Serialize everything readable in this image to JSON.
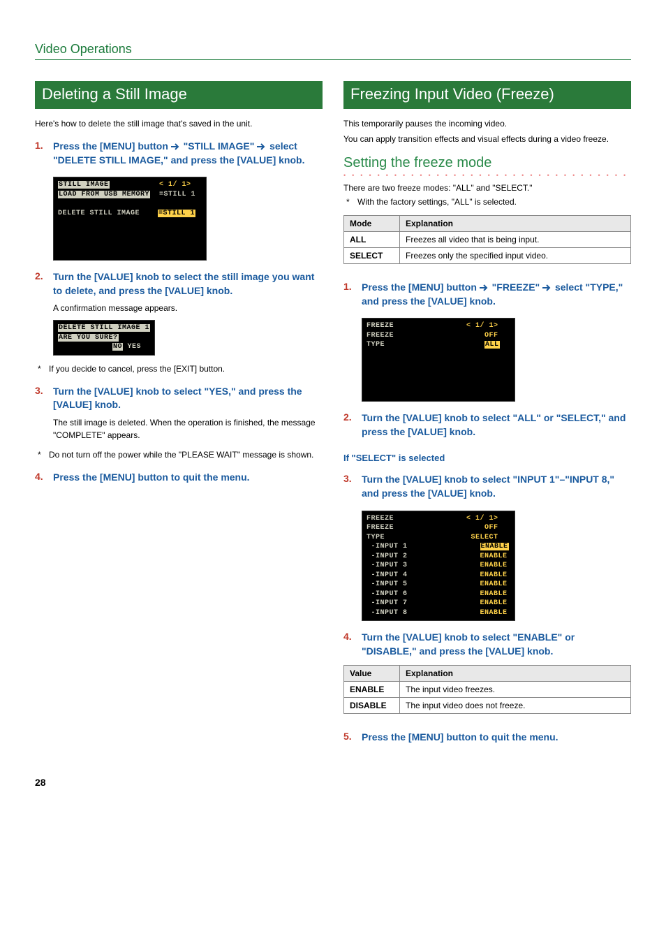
{
  "section_header": "Video Operations",
  "page_number": "28",
  "left": {
    "title": "Deleting a Still Image",
    "intro": "Here's how to delete the still image that's saved in the unit.",
    "step1_num": "1.",
    "step1a": "Press the [MENU] button ",
    "step1b": " \"STILL IMAGE\" ",
    "step1c": " select \"DELETE STILL IMAGE,\" and press the [VALUE] knob.",
    "lcd1_l1a": "STILL IMAGE",
    "lcd1_l1b": "< 1/ 1>",
    "lcd1_l2a": "LOAD FROM USB MEMORY",
    "lcd1_l2b": "=STILL 1",
    "lcd1_l4a": "DELETE STILL IMAGE",
    "lcd1_l4b": "=STILL 1",
    "step2_num": "2.",
    "step2": "Turn the [VALUE] knob to select the still image you want to delete, and press the [VALUE] knob.",
    "step2_cont": "A confirmation message appears.",
    "lcd2_l1": "DELETE STILL IMAGE 1",
    "lcd2_l2": "ARE YOU SURE?",
    "lcd2_l3a": "NO",
    "lcd2_l3b": " YES",
    "note1": "If you decide to cancel, press the [EXIT] button.",
    "step3_num": "3.",
    "step3": "Turn the [VALUE] knob to select \"YES,\" and press the [VALUE] knob.",
    "step3_cont": "The still image is deleted. When the operation is finished, the message \"COMPLETE\" appears.",
    "note2": "Do not turn off the power while the \"PLEASE WAIT\" message is shown.",
    "step4_num": "4.",
    "step4": "Press the [MENU] button to quit the menu."
  },
  "right": {
    "title": "Freezing Input Video (Freeze)",
    "intro1": "This temporarily pauses the incoming video.",
    "intro2": "You can apply transition effects and visual effects during a video freeze.",
    "subhead": "Setting the freeze mode",
    "mode_intro": "There are two freeze modes: \"ALL\" and \"SELECT.\"",
    "mode_note": "With the factory settings, \"ALL\" is selected.",
    "table1": {
      "h1": "Mode",
      "h2": "Explanation",
      "r1c1": "ALL",
      "r1c2": "Freezes all video that is being input.",
      "r2c1": "SELECT",
      "r2c2": "Freezes only the specified input video."
    },
    "step1_num": "1.",
    "step1a": "Press the [MENU] button ",
    "step1b": " \"FREEZE\" ",
    "step1c": " select \"TYPE,\" and press the [VALUE] knob.",
    "lcd1_l1a": "FREEZE",
    "lcd1_l1b": "< 1/ 1>",
    "lcd1_l2a": "FREEZE",
    "lcd1_l2b": "OFF",
    "lcd1_l3a": "TYPE",
    "lcd1_l3b": "ALL",
    "step2_num": "2.",
    "step2": "Turn the [VALUE] knob to select \"ALL\" or \"SELECT,\" and press the [VALUE] knob.",
    "select_sub": "If \"SELECT\" is selected",
    "step3_num": "3.",
    "step3": "Turn the [VALUE] knob to select \"INPUT 1\"–\"INPUT 8,\" and press the [VALUE] knob.",
    "lcd2_l1a": "FREEZE",
    "lcd2_l1b": "< 1/ 1>",
    "lcd2_l2a": "FREEZE",
    "lcd2_l2b": "OFF",
    "lcd2_l3a": "TYPE",
    "lcd2_l3b": "SELECT",
    "lcd2_i1a": " -INPUT 1",
    "lcd2_i1b": "ENABLE",
    "lcd2_i2a": " -INPUT 2",
    "lcd2_i2b": "ENABLE",
    "lcd2_i3a": " -INPUT 3",
    "lcd2_i3b": "ENABLE",
    "lcd2_i4a": " -INPUT 4",
    "lcd2_i4b": "ENABLE",
    "lcd2_i5a": " -INPUT 5",
    "lcd2_i5b": "ENABLE",
    "lcd2_i6a": " -INPUT 6",
    "lcd2_i6b": "ENABLE",
    "lcd2_i7a": " -INPUT 7",
    "lcd2_i7b": "ENABLE",
    "lcd2_i8a": " -INPUT 8",
    "lcd2_i8b": "ENABLE",
    "step4_num": "4.",
    "step4": "Turn the [VALUE] knob to select \"ENABLE\" or \"DISABLE,\" and press the [VALUE] knob.",
    "table2": {
      "h1": "Value",
      "h2": "Explanation",
      "r1c1": "ENABLE",
      "r1c2": "The input video freezes.",
      "r2c1": "DISABLE",
      "r2c2": "The input video does not freeze."
    },
    "step5_num": "5.",
    "step5": "Press the [MENU] button to quit the menu."
  }
}
